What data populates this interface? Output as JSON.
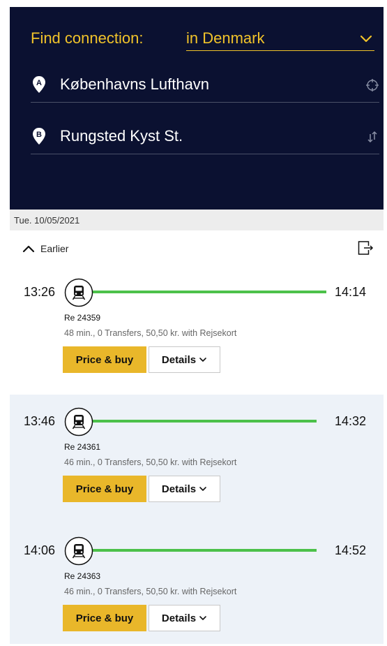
{
  "search": {
    "find_prefix": "Find connection:",
    "find_country": "in Denmark",
    "from": {
      "badge": "A",
      "name": "Københavns Lufthavn"
    },
    "to": {
      "badge": "B",
      "name": "Rungsted Kyst St."
    }
  },
  "results": {
    "date": "Tue. 10/05/2021",
    "earlier_label": "Earlier",
    "connections": [
      {
        "dep": "13:26",
        "arr": "14:14",
        "train": "Re 24359",
        "meta": "48 min., 0 Transfers, 50,50 kr. with Rejsekort",
        "buy_label": "Price & buy",
        "details_label": "Details"
      },
      {
        "dep": "13:46",
        "arr": "14:32",
        "train": "Re 24361",
        "meta": "46 min., 0 Transfers, 50,50 kr. with Rejsekort",
        "buy_label": "Price & buy",
        "details_label": "Details"
      },
      {
        "dep": "14:06",
        "arr": "14:52",
        "train": "Re 24363",
        "meta": "46 min., 0 Transfers, 50,50 kr. with Rejsekort",
        "buy_label": "Price & buy",
        "details_label": "Details"
      }
    ]
  },
  "colors": {
    "header_bg": "#0b1131",
    "accent_yellow": "#f1c32a",
    "buy_button": "#e9b72a",
    "route_line": "#4cc14a",
    "shaded_row": "#edf2f8"
  },
  "icons": {
    "find_toggle": "chevron-down-icon",
    "from_pin": "pin-a-icon",
    "to_pin": "pin-b-icon",
    "locate": "crosshair-icon",
    "swap": "swap-icon",
    "earlier": "chevron-up-icon",
    "export": "export-icon",
    "train": "train-icon"
  }
}
